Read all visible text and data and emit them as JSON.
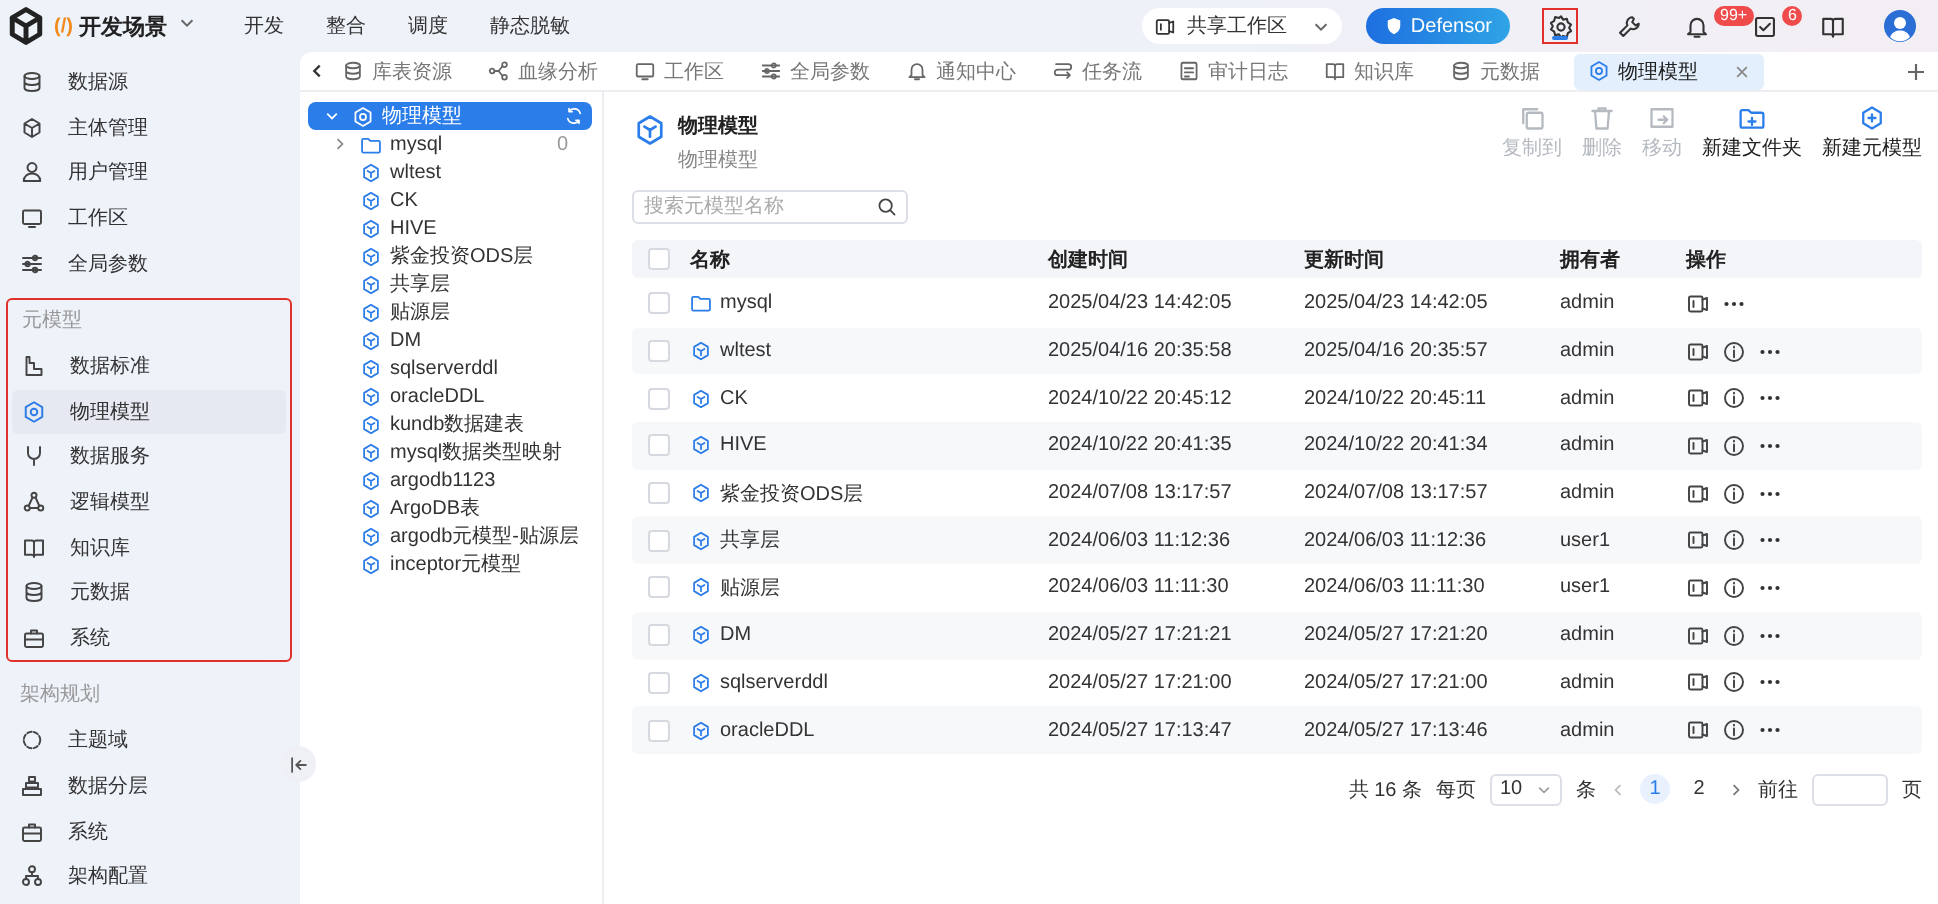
{
  "header": {
    "brand_mark": "(/)",
    "brand": "开发场景",
    "nav": [
      {
        "label": "开发"
      },
      {
        "label": "整合"
      },
      {
        "label": "调度"
      },
      {
        "label": "静态脱敏"
      }
    ],
    "workspace": "共享工作区",
    "defensor": "Defensor",
    "actions": [
      {
        "kind": "gear",
        "highlighted": true
      },
      {
        "kind": "wrench",
        "highlighted": false
      },
      {
        "kind": "bell",
        "badge": "99+",
        "highlighted": false
      },
      {
        "kind": "task",
        "badge": "6",
        "highlighted": false
      },
      {
        "kind": "book",
        "highlighted": false
      },
      {
        "kind": "avatar",
        "highlighted": false
      }
    ]
  },
  "sidebar": {
    "sections": [
      {
        "items": [
          {
            "label": "数据源",
            "selected": false
          },
          {
            "label": "主体管理",
            "selected": false
          },
          {
            "label": "用户管理",
            "selected": false
          },
          {
            "label": "工作区",
            "selected": false
          },
          {
            "label": "全局参数",
            "selected": false
          }
        ]
      },
      {
        "title": "元模型",
        "highlighted": true,
        "items": [
          {
            "label": "数据标准",
            "selected": false
          },
          {
            "label": "物理模型",
            "selected": true
          },
          {
            "label": "数据服务",
            "selected": false
          },
          {
            "label": "逻辑模型",
            "selected": false
          },
          {
            "label": "知识库",
            "selected": false
          },
          {
            "label": "元数据",
            "selected": false
          },
          {
            "label": "系统",
            "selected": false
          }
        ]
      },
      {
        "title": "架构规划",
        "items": [
          {
            "label": "主题域",
            "selected": false
          },
          {
            "label": "数据分层",
            "selected": false
          },
          {
            "label": "系统",
            "selected": false
          },
          {
            "label": "架构配置",
            "selected": false
          }
        ]
      }
    ]
  },
  "tabs": [
    {
      "label": "库表资源",
      "selected": false
    },
    {
      "label": "血缘分析",
      "selected": false
    },
    {
      "label": "工作区",
      "selected": false
    },
    {
      "label": "全局参数",
      "selected": false
    },
    {
      "label": "通知中心",
      "selected": false
    },
    {
      "label": "任务流",
      "selected": false
    },
    {
      "label": "审计日志",
      "selected": false
    },
    {
      "label": "知识库",
      "selected": false
    },
    {
      "label": "元数据",
      "selected": false
    },
    {
      "label": "物理模型",
      "selected": true
    }
  ],
  "tree": {
    "label": "物理模型",
    "selected": true,
    "expanded": true,
    "children": [
      {
        "label": "mysql",
        "kind": "folder",
        "count": "0",
        "expanded": false
      },
      {
        "label": "wltest",
        "kind": "model"
      },
      {
        "label": "CK",
        "kind": "model"
      },
      {
        "label": "HIVE",
        "kind": "model"
      },
      {
        "label": "紫金投资ODS层",
        "kind": "model"
      },
      {
        "label": "共享层",
        "kind": "model"
      },
      {
        "label": "贴源层",
        "kind": "model"
      },
      {
        "label": "DM",
        "kind": "model"
      },
      {
        "label": "sqlserverddl",
        "kind": "model"
      },
      {
        "label": "oracleDDL",
        "kind": "model"
      },
      {
        "label": "kundb数据建表",
        "kind": "model"
      },
      {
        "label": "mysql数据类型映射",
        "kind": "model"
      },
      {
        "label": "argodb1123",
        "kind": "model"
      },
      {
        "label": "ArgoDB表",
        "kind": "model"
      },
      {
        "label": "argodb元模型-贴源层",
        "kind": "model"
      },
      {
        "label": "inceptor元模型",
        "kind": "model"
      }
    ]
  },
  "page": {
    "title": "物理模型",
    "subtitle": "物理模型",
    "toolbar": [
      {
        "label": "复制到",
        "disabled": true
      },
      {
        "label": "删除",
        "disabled": true
      },
      {
        "label": "移动",
        "disabled": true
      },
      {
        "label": "新建文件夹",
        "disabled": false
      },
      {
        "label": "新建元模型",
        "disabled": false
      }
    ],
    "search": {
      "placeholder": "搜索元模型名称"
    },
    "table": {
      "select_all": {
        "checked": false
      },
      "columns": [
        "名称",
        "创建时间",
        "更新时间",
        "拥有者",
        "操作"
      ],
      "rows": [
        {
          "kind": "folder",
          "name": "mysql",
          "created": "2025/04/23 14:42:05",
          "updated": "2025/04/23 14:42:05",
          "owner": "admin",
          "checked": false
        },
        {
          "kind": "model",
          "name": "wltest",
          "created": "2025/04/16 20:35:58",
          "updated": "2025/04/16 20:35:57",
          "owner": "admin",
          "checked": false
        },
        {
          "kind": "model",
          "name": "CK",
          "created": "2024/10/22 20:45:12",
          "updated": "2024/10/22 20:45:11",
          "owner": "admin",
          "checked": false
        },
        {
          "kind": "model",
          "name": "HIVE",
          "created": "2024/10/22 20:41:35",
          "updated": "2024/10/22 20:41:34",
          "owner": "admin",
          "checked": false
        },
        {
          "kind": "model",
          "name": "紫金投资ODS层",
          "created": "2024/07/08 13:17:57",
          "updated": "2024/07/08 13:17:57",
          "owner": "admin",
          "checked": false
        },
        {
          "kind": "model",
          "name": "共享层",
          "created": "2024/06/03 11:12:36",
          "updated": "2024/06/03 11:12:36",
          "owner": "user1",
          "checked": false
        },
        {
          "kind": "model",
          "name": "贴源层",
          "created": "2024/06/03 11:11:30",
          "updated": "2024/06/03 11:11:30",
          "owner": "user1",
          "checked": false
        },
        {
          "kind": "model",
          "name": "DM",
          "created": "2024/05/27 17:21:21",
          "updated": "2024/05/27 17:21:20",
          "owner": "admin",
          "checked": false
        },
        {
          "kind": "model",
          "name": "sqlserverddl",
          "created": "2024/05/27 17:21:00",
          "updated": "2024/05/27 17:21:00",
          "owner": "admin",
          "checked": false
        },
        {
          "kind": "model",
          "name": "oracleDDL",
          "created": "2024/05/27 17:13:47",
          "updated": "2024/05/27 17:13:46",
          "owner": "admin",
          "checked": false
        }
      ]
    },
    "pagination": {
      "total": "共 16 条",
      "per_page_label": "每页",
      "per_page": "10",
      "unit": "条",
      "pages": [
        {
          "label": "1",
          "selected": true
        },
        {
          "label": "2",
          "selected": false
        }
      ],
      "goto_label": "前往",
      "goto_suffix": "页"
    }
  }
}
